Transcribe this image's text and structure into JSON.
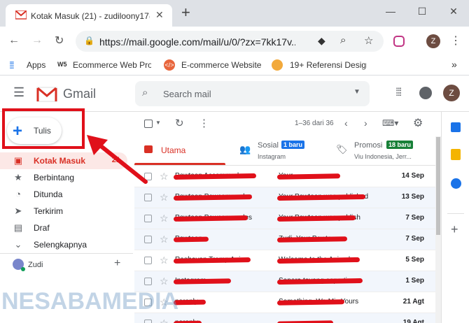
{
  "browser": {
    "tab_title": "Kotak Masuk (21) - zudiloony17@",
    "new_tab_symbol": "+",
    "url": "https://mail.google.com/mail/u/0/?zx=7kk17v...",
    "profile_initial": "Z",
    "bookmarks": [
      {
        "label": "Apps"
      },
      {
        "label": "Ecommerce Web Proj"
      },
      {
        "label": "E-commerce Website"
      },
      {
        "label": "19+ Referensi Design"
      }
    ],
    "more_bookmarks": "»"
  },
  "gmail": {
    "logo_text": "Gmail",
    "search_placeholder": "Search mail",
    "account_initial": "Z",
    "compose_label": "Tulis",
    "nav": [
      {
        "label": "Kotak Masuk",
        "count": "21",
        "icon": "inbox-icon"
      },
      {
        "label": "Berbintang",
        "icon": "star-icon"
      },
      {
        "label": "Ditunda",
        "icon": "clock-icon"
      },
      {
        "label": "Terkirim",
        "icon": "send-icon"
      },
      {
        "label": "Draf",
        "icon": "draft-icon"
      },
      {
        "label": "Selengkapnya",
        "icon": "chevron-down-icon"
      }
    ],
    "hangouts_user": "Zudi",
    "pagination": "1–36 dari 36",
    "tabs": [
      {
        "label": "Utama"
      },
      {
        "label": "Sosial",
        "badge": "1 baru",
        "sub": "Instagram",
        "badge_color": "#1a73e8"
      },
      {
        "label": "Promosi",
        "badge": "18 baru",
        "sub": "Viu Indonesia, Jerr...",
        "badge_color": "#188038"
      }
    ],
    "emails": [
      {
        "sender": "Pewtoon Accommodes",
        "subject": "Your...",
        "date": "14 Sep",
        "read": false
      },
      {
        "sender": "Powtoon Powcommodes",
        "subject": "Your Powtoon was published",
        "date": "13 Sep",
        "read": true
      },
      {
        "sender": "Powtoon Powcommodes",
        "subject": "Your Powtoon was publish",
        "date": "7 Sep",
        "read": true
      },
      {
        "sender": "Powtoon",
        "subject": "Zudi, Your Powtoon...",
        "date": "7 Sep",
        "read": true
      },
      {
        "sender": "Raghavan Tramp Anim",
        "subject": "Welcome to the Animaker",
        "date": "5 Sep",
        "read": false
      },
      {
        "sender": "Instagram",
        "subject": "Sapera tayang seperti...",
        "date": "1 Sep",
        "read": true
      },
      {
        "sender": "noreply",
        "subject": "Something, Wa Mix Yours",
        "date": "21 Agt",
        "read": false
      },
      {
        "sender": "noreply",
        "subject": "...",
        "date": "19 Agt",
        "read": true
      }
    ]
  },
  "watermark": "NESABAMEDIA",
  "colors": {
    "accent_red": "#d93025",
    "annotation_red": "#e0101a",
    "selected_nav_bg": "#fce8e6"
  }
}
